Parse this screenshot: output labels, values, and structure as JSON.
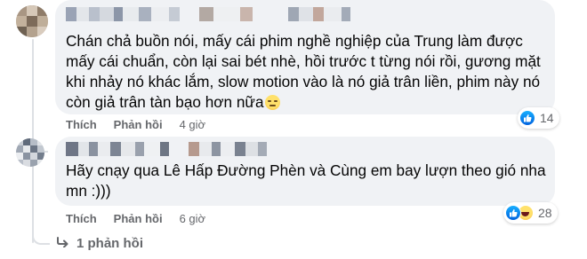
{
  "comments": [
    {
      "author": "",
      "text": "Chán chả buồn nói, mấy cái phim nghề nghiệp của Trung làm được\nmấy cái chuẩn, còn lại sai bét nhè, hồi trước t từng nói rồi, gương mặt\nkhi nhảy nó khác lắm, slow motion vào là nó giả trân liền, phim này nó\ncòn giả trân tàn bạo hơn nữa",
      "trailing_emoji": "sad-face-emoji",
      "like_label": "Thích",
      "reply_label": "Phản hồi",
      "time": "4 giờ",
      "reaction_icons": [
        "like-icon"
      ],
      "reaction_count": "14"
    },
    {
      "author": "",
      "text": "Hãy cnạy qua Lê Hấp Đường Phèn và Cùng em bay lượn theo gió nha\nmn :)))",
      "like_label": "Thích",
      "reply_label": "Phản hồi",
      "time": "6 giờ",
      "reaction_icons": [
        "like-icon",
        "haha-icon"
      ],
      "reaction_count": "28"
    }
  ],
  "replies_link": {
    "icon": "reply-arrow-icon",
    "label": "1 phản hồi"
  },
  "colors": {
    "bubble": "#f0f2f5",
    "meta_text": "#65676b",
    "body_text": "#050505",
    "like_blue": "#0866ff"
  }
}
